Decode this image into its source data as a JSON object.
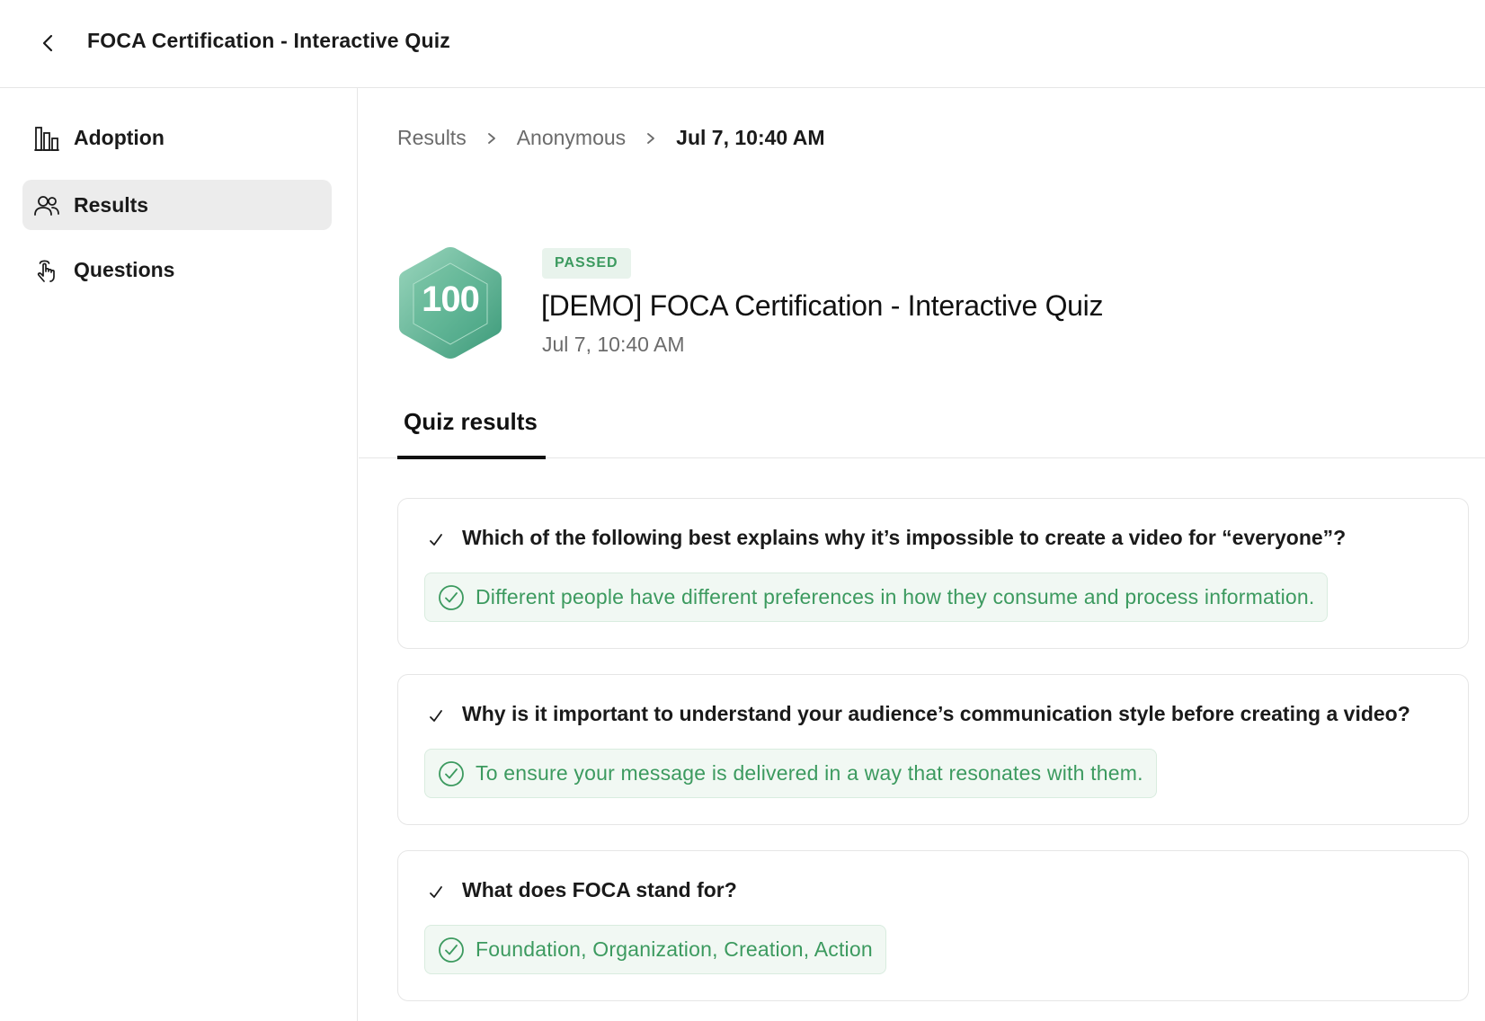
{
  "header": {
    "title": "FOCA Certification - Interactive Quiz",
    "back_icon": "chevron-left-icon"
  },
  "sidebar": {
    "items": [
      {
        "label": "Adoption",
        "icon": "bar-chart-icon",
        "active": false
      },
      {
        "label": "Results",
        "icon": "users-icon",
        "active": true
      },
      {
        "label": "Questions",
        "icon": "pointer-hand-icon",
        "active": false
      }
    ]
  },
  "breadcrumb": {
    "items": [
      "Results",
      "Anonymous",
      "Jul 7, 10:40 AM"
    ]
  },
  "result": {
    "score": "100",
    "status": "PASSED",
    "title": "[DEMO] FOCA Certification - Interactive Quiz",
    "date": "Jul 7, 10:40 AM"
  },
  "tabs": [
    {
      "label": "Quiz results",
      "active": true
    }
  ],
  "questions": [
    {
      "question": "Which of the following best explains why it’s impossible to create a video for “everyone”?",
      "answer": "Different people have different preferences in how they consume and process information.",
      "correct": true
    },
    {
      "question": "Why is it important to understand your audience’s communication style before creating a video?",
      "answer": "To ensure your message is delivered in a way that resonates with them.",
      "correct": true
    },
    {
      "question": "What does FOCA stand for?",
      "answer": "Foundation, Organization, Creation, Action",
      "correct": true
    }
  ],
  "colors": {
    "success": "#3c9a5f",
    "success_bg": "#f1f8f3",
    "badge_gradient_start": "#8fd0b5",
    "badge_gradient_end": "#3e9d7c",
    "active_nav_bg": "#ececec"
  }
}
